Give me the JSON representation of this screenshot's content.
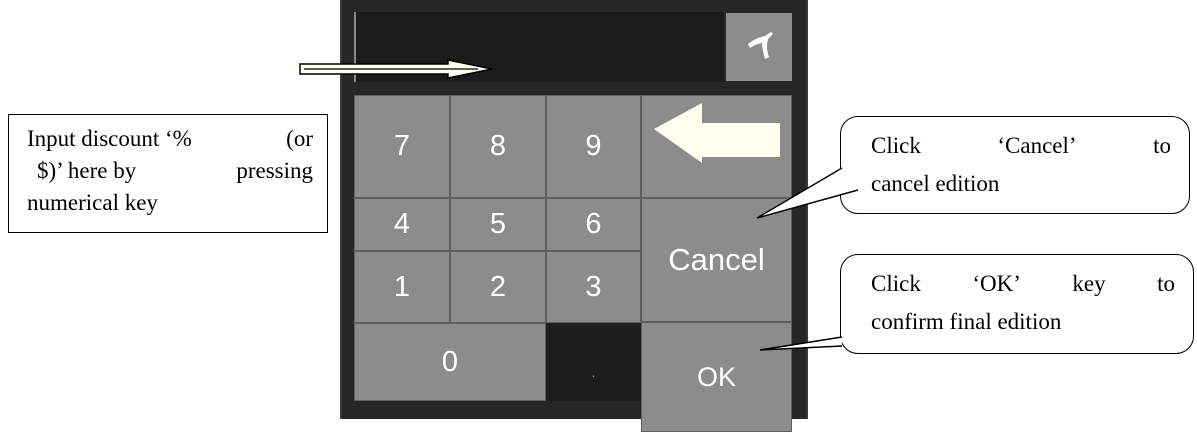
{
  "dialog": {
    "input_value": "",
    "close_icon": "close-icon"
  },
  "keypad": {
    "keys": {
      "k7": "7",
      "k8": "8",
      "k9": "9",
      "k4": "4",
      "k5": "5",
      "k6": "6",
      "k1": "1",
      "k2": "2",
      "k3": "3",
      "k0": "0",
      "dot": ".",
      "backspace_icon": "backspace-arrow-icon",
      "cancel": "Cancel",
      "ok": "OK"
    }
  },
  "annotations": {
    "input_note": {
      "line1_a": "Input discount ‘%",
      "line1_b": "(or",
      "line2_a": "$)’ here by",
      "line2_b": "pressing",
      "line3": "numerical key"
    },
    "cancel_note": {
      "w1": "Click",
      "w2": "‘Cancel’",
      "w3": "to",
      "line2": "cancel edition"
    },
    "ok_note": {
      "w1": "Click",
      "w2": "‘OK’",
      "w3": "key",
      "w4": "to",
      "line2": "confirm final edition"
    }
  },
  "colors": {
    "panel_bg": "#262626",
    "key_bg": "#8c8c8c",
    "key_text": "#ffffff",
    "arrow_fill": "#fffff0"
  }
}
